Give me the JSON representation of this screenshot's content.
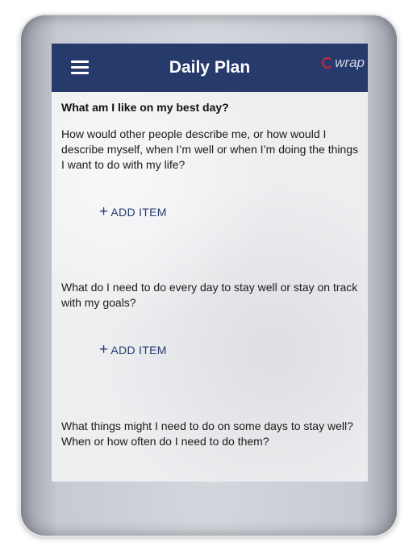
{
  "header": {
    "title": "Daily Plan",
    "logo_text": "wrap",
    "menu_icon": "hamburger-menu-icon"
  },
  "sections": [
    {
      "heading": "What am I like on my best day?",
      "question": "How would other people describe me, or how would I describe myself, when I’m well or when I’m doing the things I want to do with my life?",
      "add_label": "ADD ITEM"
    },
    {
      "question": "What do I need to do every day to stay well or stay on track with my goals?",
      "add_label": "ADD ITEM"
    },
    {
      "question": "What things might I need to do on some days to stay well? When or how often do I need to do them?"
    }
  ],
  "colors": {
    "header_bg": "#263a6c",
    "accent": "#263a6c",
    "logo_mark": "#c7293b",
    "screen_bg": "#eceef0"
  }
}
